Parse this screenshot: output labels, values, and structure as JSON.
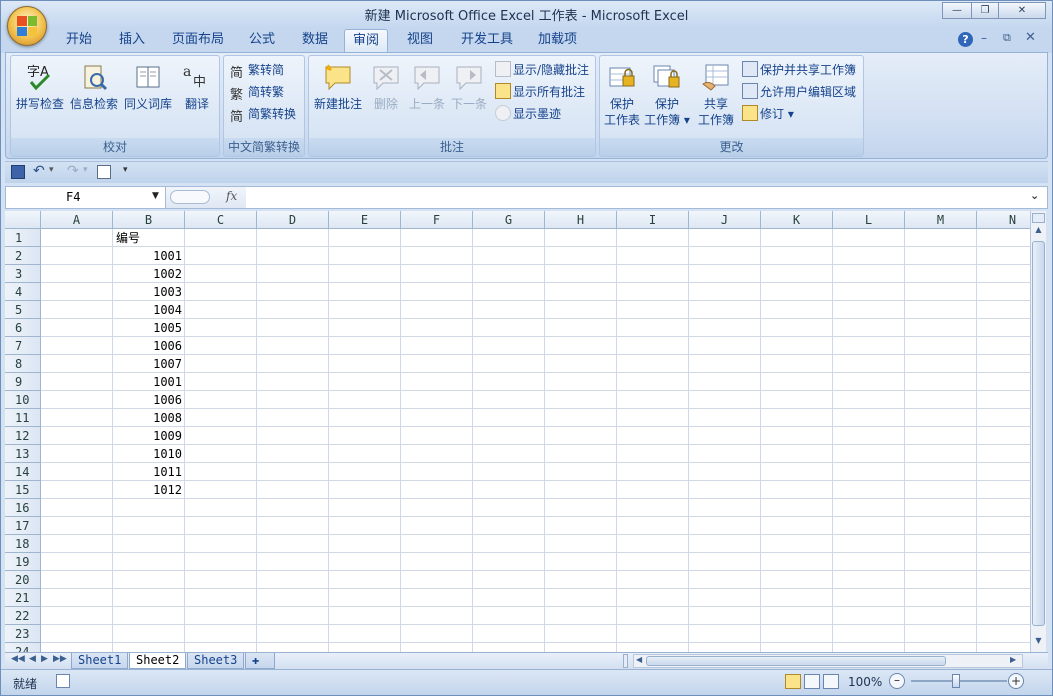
{
  "window": {
    "title": "新建 Microsoft Office Excel 工作表 - Microsoft Excel"
  },
  "tabs": [
    "开始",
    "插入",
    "页面布局",
    "公式",
    "数据",
    "审阅",
    "视图",
    "开发工具",
    "加载项"
  ],
  "active_tab": "审阅",
  "ribbon": {
    "proofing": {
      "label": "校对",
      "spell": "拼写检查",
      "research": "信息检索",
      "thesaurus": "同义词库",
      "translate": "翻译"
    },
    "chinese": {
      "label": "中文简繁转换",
      "to_simp": "繁转简",
      "to_trad": "简转繁",
      "convert": "简繁转换"
    },
    "comments": {
      "label": "批注",
      "new": "新建批注",
      "delete": "删除",
      "prev": "上一条",
      "next": "下一条",
      "show_hide": "显示/隐藏批注",
      "show_all": "显示所有批注",
      "show_ink": "显示墨迹"
    },
    "changes": {
      "label": "更改",
      "protect_sheet_1": "保护",
      "protect_sheet_2": "工作表",
      "protect_wb_1": "保护",
      "protect_wb_2": "工作簿",
      "share_wb_1": "共享",
      "share_wb_2": "工作簿",
      "protect_share": "保护并共享工作簿",
      "allow_edit": "允许用户编辑区域",
      "track": "修订"
    }
  },
  "formula_bar": {
    "name_box": "F4",
    "fx": "fx",
    "content": ""
  },
  "columns": [
    "A",
    "B",
    "C",
    "D",
    "E",
    "F",
    "G",
    "H",
    "I",
    "J",
    "K",
    "L",
    "M",
    "N"
  ],
  "rows": [
    "1",
    "2",
    "3",
    "4",
    "5",
    "6",
    "7",
    "8",
    "9",
    "10",
    "11",
    "12",
    "13",
    "14",
    "15",
    "16",
    "17",
    "18",
    "19",
    "20",
    "21",
    "22",
    "23",
    "24"
  ],
  "cells_b": [
    "编号",
    "1001",
    "1002",
    "1003",
    "1004",
    "1005",
    "1006",
    "1007",
    "1001",
    "1006",
    "1008",
    "1009",
    "1010",
    "1011",
    "1012"
  ],
  "sheets": [
    "Sheet1",
    "Sheet2",
    "Sheet3"
  ],
  "active_sheet": "Sheet2",
  "status": {
    "ready": "就绪",
    "zoom": "100%"
  }
}
